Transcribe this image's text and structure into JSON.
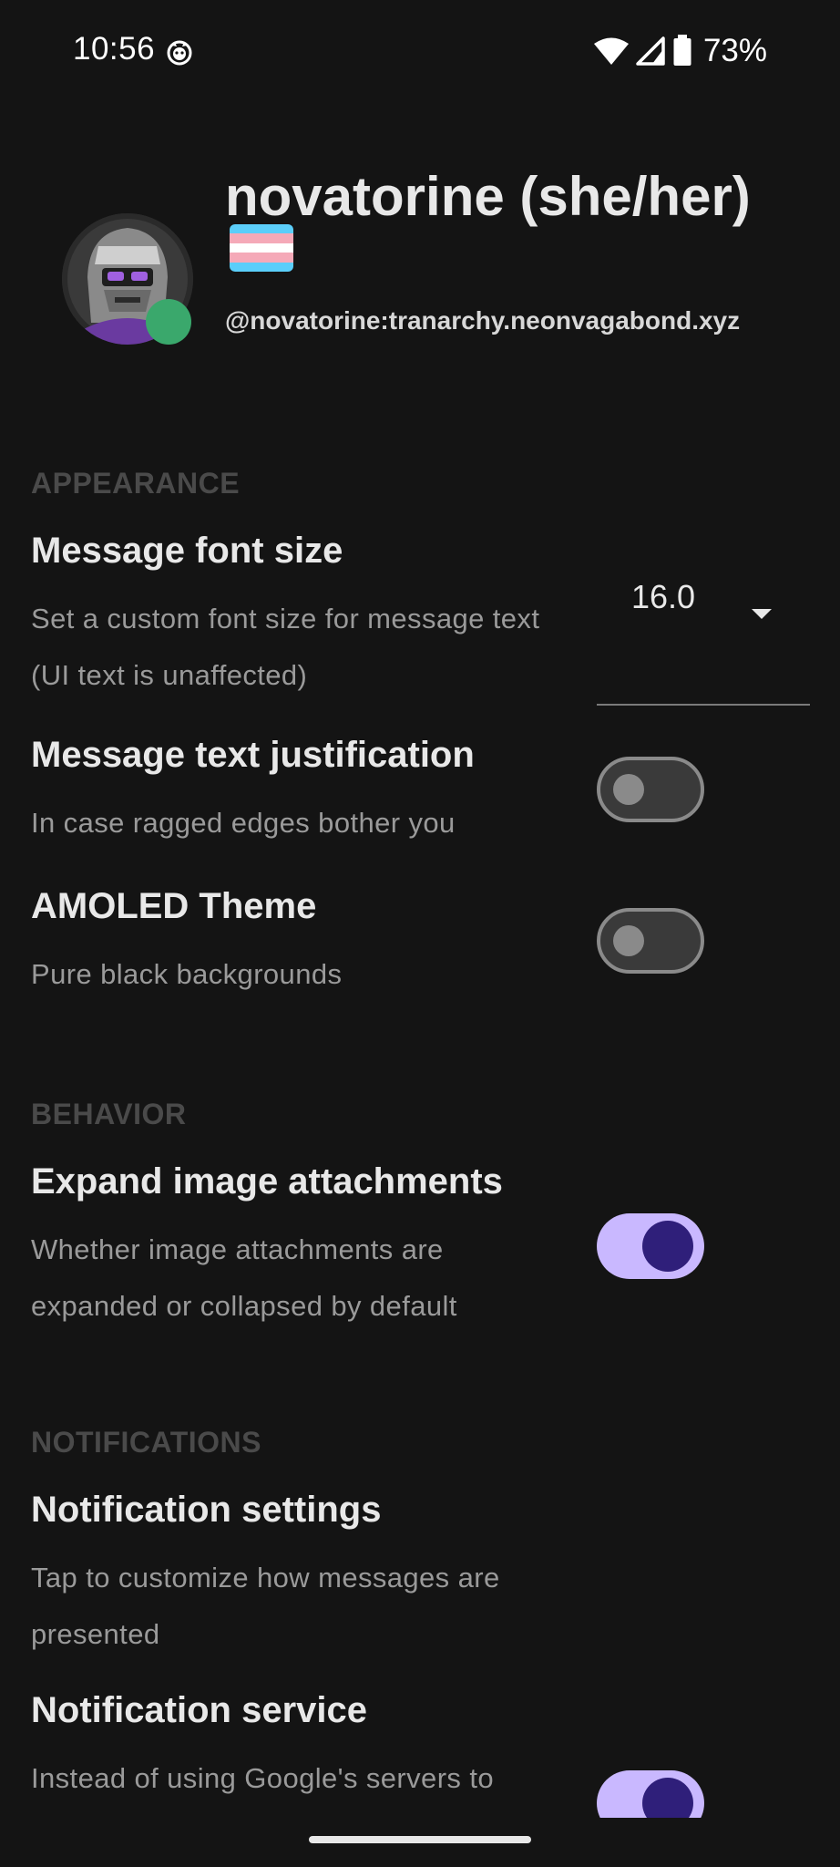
{
  "status_bar": {
    "time": "10:56",
    "battery": "73%",
    "icons": [
      "cat-notification-icon",
      "wifi-icon",
      "cell-signal-icon",
      "battery-icon"
    ]
  },
  "profile": {
    "display_name": "novatorine (she/her)",
    "flag": "transgender-pride-flag",
    "user_id": "@novatorine:tranarchy.neonvagabond.xyz",
    "presence": "online"
  },
  "colors": {
    "background": "#141414",
    "accent": "#c9b8ff",
    "accent_dark": "#2f1f7a",
    "presence_green": "#3aa86c",
    "section_header": "#4a4a4a"
  },
  "sections": {
    "appearance": {
      "header": "APPEARANCE",
      "font_size": {
        "title": "Message font size",
        "description": "Set a custom font size for message text (UI text is unaffected)",
        "value": "16.0"
      },
      "justification": {
        "title": "Message text justification",
        "description": "In case ragged edges bother you",
        "enabled": false
      },
      "amoled": {
        "title": "AMOLED Theme",
        "description": "Pure black backgrounds",
        "enabled": false
      }
    },
    "behavior": {
      "header": "BEHAVIOR",
      "expand_images": {
        "title": "Expand image attachments",
        "description": "Whether image attachments are expanded or collapsed by default",
        "enabled": true
      }
    },
    "notifications": {
      "header": "NOTIFICATIONS",
      "notification_settings": {
        "title": "Notification settings",
        "description": "Tap to customize how messages are presented"
      },
      "notification_service": {
        "title": "Notification service",
        "description": "Instead of using Google's servers to",
        "enabled": true
      }
    }
  }
}
